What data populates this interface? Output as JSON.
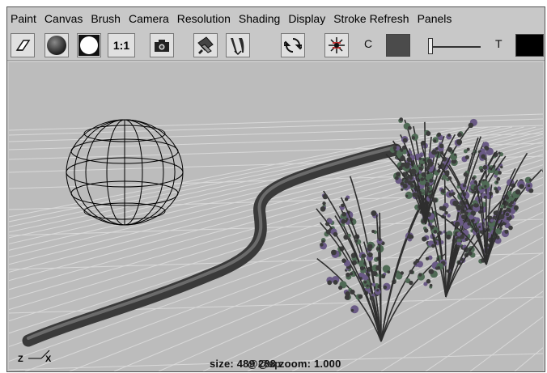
{
  "menubar": {
    "items": [
      "Paint",
      "Canvas",
      "Brush",
      "Camera",
      "Resolution",
      "Shading",
      "Display",
      "Stroke Refresh",
      "Panels"
    ]
  },
  "toolbar": {
    "buttons": [
      {
        "name": "eraser",
        "icon": "eraser-icon"
      },
      {
        "name": "shaded-sphere",
        "icon": "shaded-sphere-icon"
      },
      {
        "name": "white-circle",
        "icon": "white-circle-icon"
      },
      {
        "name": "actual-size",
        "label": "1:1"
      },
      {
        "name": "snapshot",
        "icon": "camera-icon"
      },
      {
        "name": "brush-tool",
        "icon": "brush-icon"
      },
      {
        "name": "paint-tool",
        "icon": "paint-tool-icon"
      },
      {
        "name": "refresh",
        "icon": "refresh-icon"
      },
      {
        "name": "grid-redraw",
        "icon": "grid-redraw-icon"
      }
    ],
    "color_label": "C",
    "color_value": "#4b4b4b",
    "slider_value": 0.0,
    "transparency_label": "T",
    "transparency_value": "#000000"
  },
  "status": {
    "text": "size:  489  288 zoom: 1.000",
    "overprint": "@@sp"
  },
  "axis": {
    "z_label": "Z",
    "x_label": "X"
  },
  "colors": {
    "background": "#bcbcbc",
    "grid": "#d9d9d9",
    "stroke": "#4a4a4a",
    "wireframe": "#000000",
    "plant_leaf": "#4f6a55",
    "plant_flower": "#6a5a86"
  }
}
